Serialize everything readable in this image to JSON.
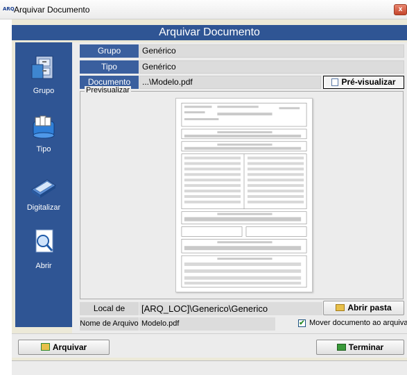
{
  "window": {
    "app_icon_text": "ARQ",
    "title": "Arquivar Documento",
    "close_glyph": "x"
  },
  "header": {
    "title": "Arquivar Documento"
  },
  "sidebar": {
    "items": [
      {
        "label": "Grupo",
        "icon": "folder-cabinet-icon"
      },
      {
        "label": "Tipo",
        "icon": "document-stack-icon"
      },
      {
        "label": "Digitalizar",
        "icon": "scanner-icon"
      },
      {
        "label": "Abrir",
        "icon": "magnifier-document-icon"
      }
    ]
  },
  "fields": {
    "grupo": {
      "label": "Grupo",
      "value": "Genérico"
    },
    "tipo": {
      "label": "Tipo",
      "value": "Genérico"
    },
    "documento": {
      "label": "Documento",
      "value": "...\\Modelo.pdf"
    }
  },
  "preview": {
    "button_label": "Pré-visualizar",
    "frame_label": "Previsualizar"
  },
  "local": {
    "label": "Local de Arquivo",
    "value": "[ARQ_LOC]\\Generico\\Generico",
    "open_button": "Abrir pasta"
  },
  "nome": {
    "label": "Nome de Arquivo",
    "value": "Modelo.pdf"
  },
  "move_option": {
    "label": "Mover documento ao arquivar",
    "checked": true,
    "check_glyph": "✔"
  },
  "actions": {
    "archive": "Arquivar",
    "finish": "Terminar"
  },
  "colors": {
    "header_blue": "#2f5594",
    "label_blue": "#3a5f9e",
    "panel_bg": "#ececec"
  }
}
